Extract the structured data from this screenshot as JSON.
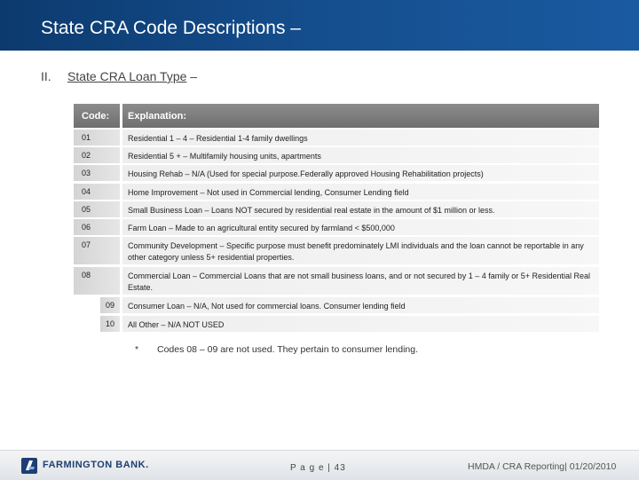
{
  "header": {
    "title": "State CRA Code Descriptions –"
  },
  "section": {
    "number": "II.",
    "title_underlined": "State CRA Loan Type",
    "title_suffix": " –"
  },
  "table": {
    "headers": {
      "code": "Code:",
      "explanation": "Explanation:"
    },
    "rows": [
      {
        "code": "01",
        "text": "Residential 1 – 4 – Residential 1-4 family dwellings"
      },
      {
        "code": "02",
        "text": "Residential 5 + – Multifamily housing units, apartments"
      },
      {
        "code": "03",
        "text": "Housing Rehab – N/A (Used for special purpose.Federally approved Housing Rehabilitation projects)"
      },
      {
        "code": "04",
        "text": "Home Improvement – Not used in Commercial lending, Consumer Lending field"
      },
      {
        "code": "05",
        "text": "Small Business Loan – Loans NOT secured by residential real estate in the amount of $1 million or less."
      },
      {
        "code": "06",
        "text": "Farm Loan – Made to an agricultural entity secured by farmland < $500,000"
      },
      {
        "code": "07",
        "text": "Community Development – Specific purpose must benefit predominately LMI individuals and the loan cannot be reportable in any other category unless 5+ residential properties."
      },
      {
        "code": "08",
        "text": "Commercial Loan – Commercial Loans that are not small business loans, and or not secured by 1 – 4 family or 5+ Residential Real Estate."
      },
      {
        "code": "09",
        "text": "Consumer Loan – N/A, Not used for commercial loans. Consumer lending field"
      },
      {
        "code": "10",
        "text": "All Other – N/A NOT USED"
      }
    ]
  },
  "footnote": {
    "marker": "*",
    "text": "Codes 08 – 09 are not used. They pertain to consumer lending."
  },
  "footer": {
    "logo_text": "FARMINGTON BANK.",
    "page": "P a g e | 43",
    "report": "HMDA / CRA Reporting| 01/20/2010"
  },
  "colors": {
    "header_blue": "#154e8e",
    "table_header_gray": "#7a7a7a",
    "logo_blue": "#1d3f72"
  }
}
